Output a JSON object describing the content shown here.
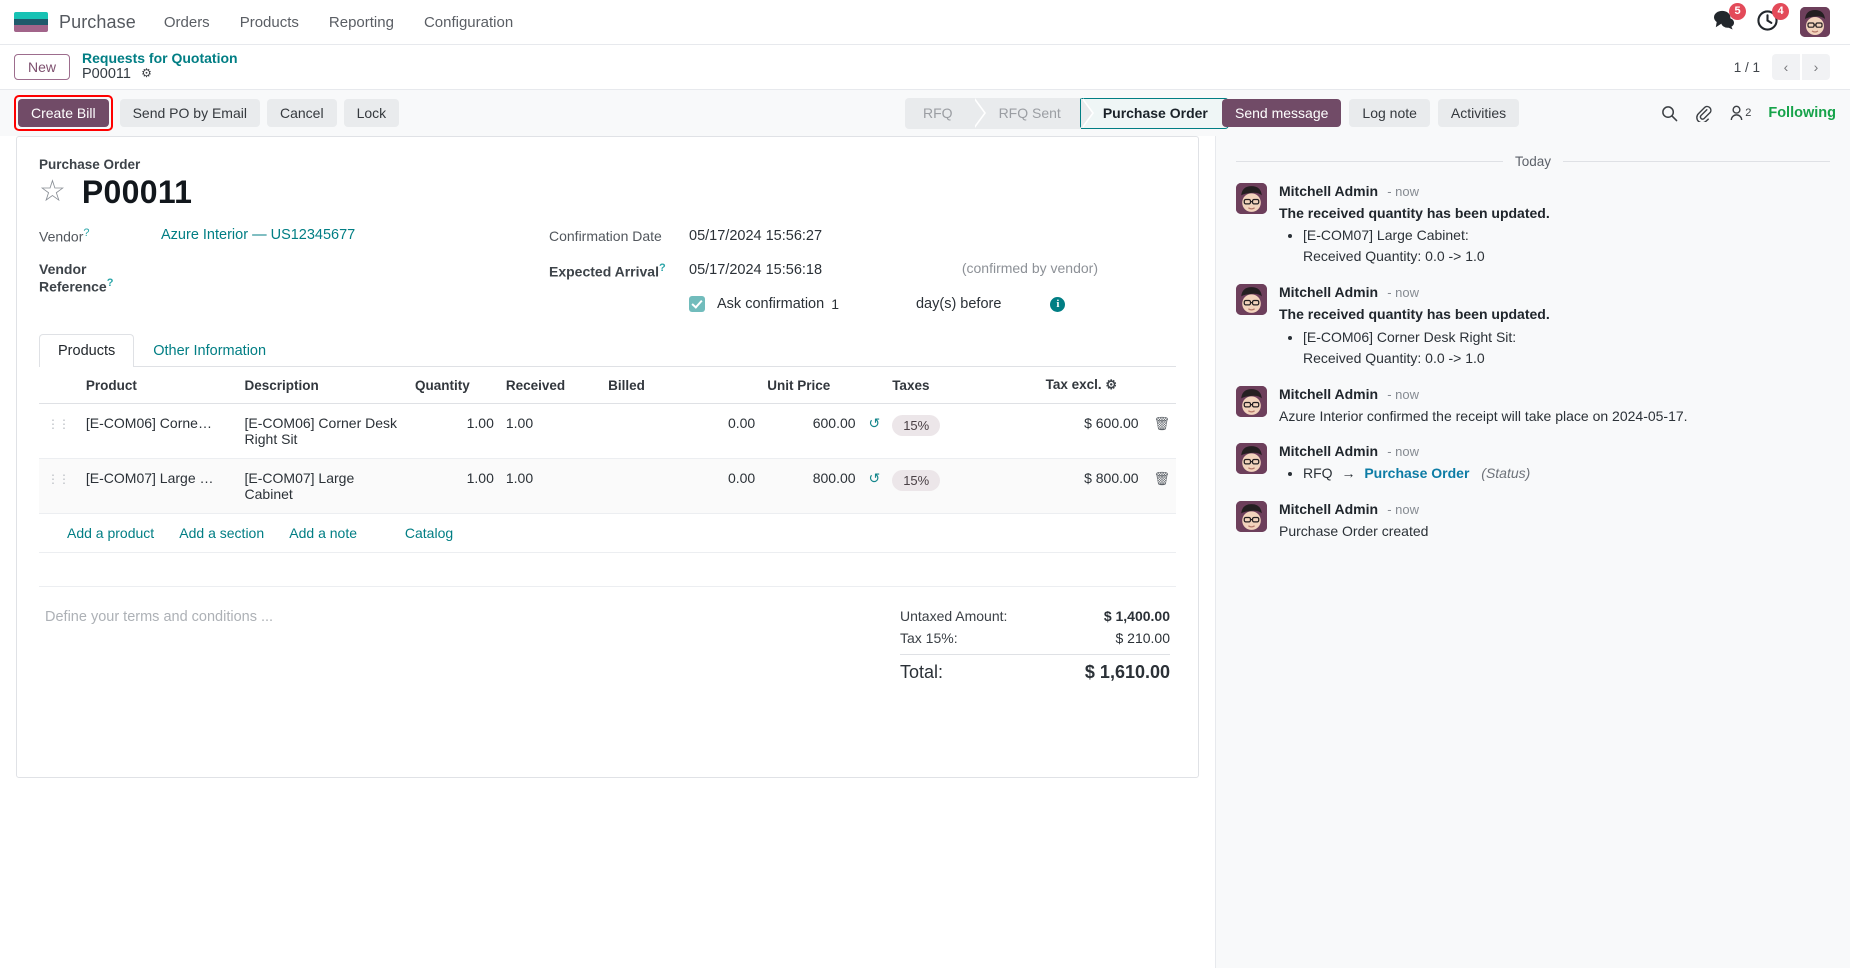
{
  "navbar": {
    "brand": "Purchase",
    "menus": [
      "Orders",
      "Products",
      "Reporting",
      "Configuration"
    ],
    "messages_badge": "5",
    "activities_badge": "4",
    "icons": {
      "messages": "chat-icon",
      "activities": "clock-icon",
      "avatar": "user-avatar"
    }
  },
  "breadcrumb": {
    "new_label": "New",
    "parent": "Requests for Quotation",
    "current": "P00011",
    "pager": "1 / 1"
  },
  "actions": {
    "create_bill": "Create Bill",
    "send_po_by_email": "Send PO by Email",
    "cancel": "Cancel",
    "lock": "Lock"
  },
  "statusbar": {
    "stages": [
      "RFQ",
      "RFQ Sent",
      "Purchase Order"
    ],
    "active": "Purchase Order"
  },
  "chatter_actions": {
    "send_message": "Send message",
    "log_note": "Log note",
    "activities": "Activities",
    "followers_count": "2",
    "following": "Following"
  },
  "form": {
    "record_label": "Purchase Order",
    "record_id": "P00011",
    "vendor_label": "Vendor",
    "vendor_value": "Azure Interior — US12345677",
    "vendor_reference_label": "Vendor Reference",
    "vendor_reference_value": "",
    "confirmation_date_label": "Confirmation Date",
    "confirmation_date_value": "05/17/2024 15:56:27",
    "expected_arrival_label": "Expected Arrival",
    "expected_arrival_value": "05/17/2024 15:56:18",
    "confirmed_note": "(confirmed by vendor)",
    "ask_confirmation_label": "Ask confirmation",
    "ask_confirmation_days": "1",
    "days_before_label": "day(s) before"
  },
  "notebook": {
    "tabs": [
      "Products",
      "Other Information"
    ],
    "active_tab": "Products"
  },
  "lines_table": {
    "headers": [
      "Product",
      "Description",
      "Quantity",
      "Received",
      "Billed",
      "Unit Price",
      "Taxes",
      "Tax excl."
    ],
    "rows": [
      {
        "product": "[E-COM06] Corne…",
        "description": "[E-COM06] Corner Desk Right Sit",
        "quantity": "1.00",
        "received": "1.00",
        "billed": "0.00",
        "unit_price": "600.00",
        "taxes": "15%",
        "subtotal": "$ 600.00"
      },
      {
        "product": "[E-COM07] Large …",
        "description": "[E-COM07] Large Cabinet",
        "quantity": "1.00",
        "received": "1.00",
        "billed": "0.00",
        "unit_price": "800.00",
        "taxes": "15%",
        "subtotal": "$ 800.00"
      }
    ],
    "add_product": "Add a product",
    "add_section": "Add a section",
    "add_note": "Add a note",
    "catalog": "Catalog"
  },
  "footer": {
    "terms_placeholder": "Define your terms and conditions ...",
    "untaxed_label": "Untaxed Amount:",
    "untaxed_value": "$ 1,400.00",
    "tax_label": "Tax 15%:",
    "tax_value": "$ 210.00",
    "total_label": "Total:",
    "total_value": "$ 1,610.00"
  },
  "chatter": {
    "day_separator": "Today",
    "messages": [
      {
        "author": "Mitchell Admin",
        "time": "- now",
        "title": "The received quantity has been updated.",
        "bullet": "[E-COM07] Large Cabinet:",
        "sub": "Received Quantity: 0.0 -> 1.0"
      },
      {
        "author": "Mitchell Admin",
        "time": "- now",
        "title": "The received quantity has been updated.",
        "bullet": "[E-COM06] Corner Desk Right Sit:",
        "sub": "Received Quantity: 0.0 -> 1.0"
      },
      {
        "author": "Mitchell Admin",
        "time": "- now",
        "body": "Azure Interior confirmed the receipt will take place on 2024-05-17."
      },
      {
        "author": "Mitchell Admin",
        "time": "- now",
        "track_old": "RFQ",
        "track_new": "Purchase Order",
        "track_field": "(Status)"
      },
      {
        "author": "Mitchell Admin",
        "time": "- now",
        "body": "Purchase Order created"
      }
    ]
  },
  "colors": {
    "brand_purple": "#714b67",
    "teal": "#017e84",
    "green": "#16a34a",
    "highlight_red": "#ff0000"
  }
}
